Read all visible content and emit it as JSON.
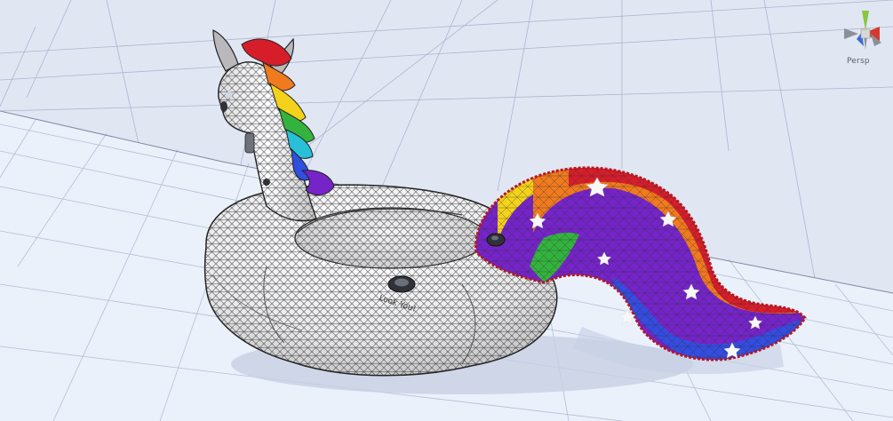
{
  "viewport": {
    "projection_label": "Persp",
    "background_color": "#e1e6f3",
    "floor_color": "#eaf1fb",
    "grid_color": "#9aa6c3",
    "wire_color": "#22252c"
  },
  "scene_object": {
    "body_color": "#f3f3f3",
    "printed_text": "Look You!",
    "stripe_colors": [
      "#d61e2a",
      "#f07a1e",
      "#f4d21b",
      "#33b33d",
      "#27c0d8",
      "#3050e0",
      "#7524c8"
    ],
    "horn_color": "#b9b9bd",
    "star_color": "#f7f7f7"
  },
  "gizmo": {
    "axis_y_color": "#8ac53e",
    "axis_x_color": "#d23a2f",
    "axis_z_color": "#3b6cd6",
    "neutral_color": "#8d8f96",
    "center_color": "#d8d8d8"
  }
}
